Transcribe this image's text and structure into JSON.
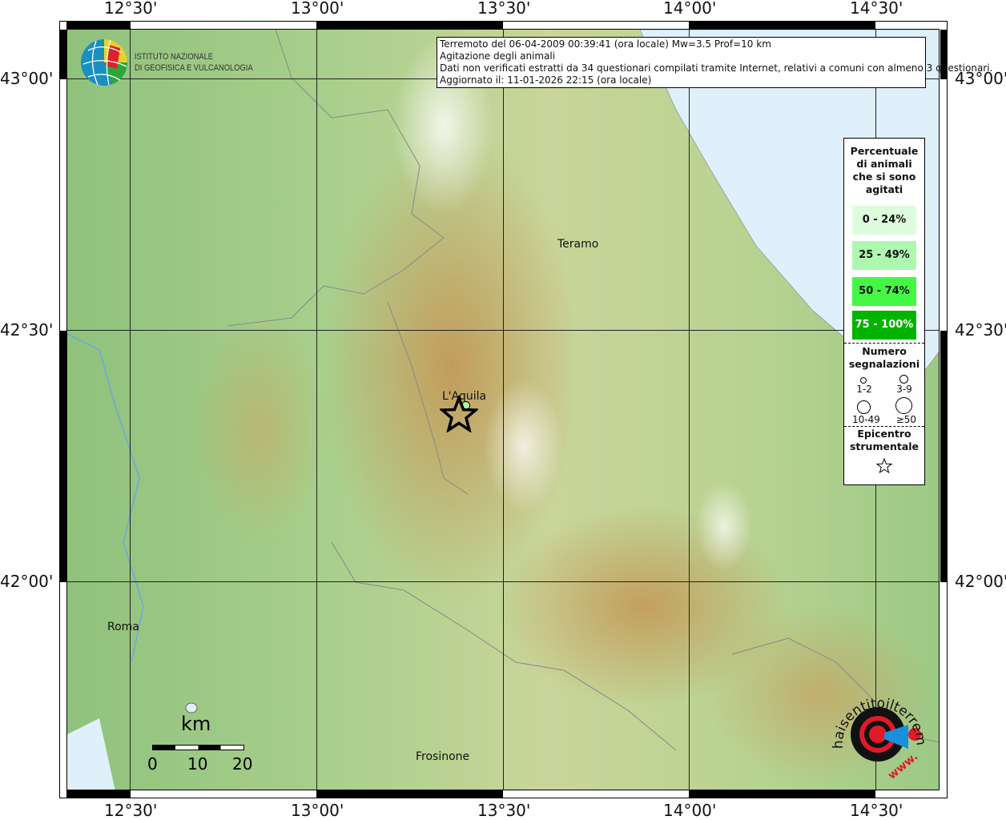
{
  "axes": {
    "lon_ticks": [
      "12°30'",
      "13°00'",
      "13°30'",
      "14°00'",
      "14°30'"
    ],
    "lat_ticks": [
      "43°00'",
      "42°30'",
      "42°00'"
    ]
  },
  "logo_ingv": {
    "line1": "ISTITUTO NAZIONALE",
    "line2": "DI GEOFISICA E VULCANOLOGIA"
  },
  "logo_hsit": {
    "text": "www.haisentitoilterremoto.it"
  },
  "info": {
    "line1": "Terremoto del 06-04-2009 00:39:41 (ora locale) Mw=3.5 Prof=10 km",
    "line2": "Agitazione degli animali",
    "line3": "Dati non verificati estratti da 34 questionari compilati tramite Internet, relativi a comuni con almeno 3 questionari.",
    "line4": "Aggiornato il: 11-01-2026 22:15 (ora locale)"
  },
  "legend": {
    "title": [
      "Percentuale",
      "di animali",
      "che si sono",
      "agitati"
    ],
    "classes": [
      {
        "label": "0 - 24%",
        "color": "#ddfcdd",
        "text_color": "#111111"
      },
      {
        "label": "25 - 49%",
        "color": "#aef7ae",
        "text_color": "#111111"
      },
      {
        "label": "50 - 74%",
        "color": "#44f744",
        "text_color": "#111111"
      },
      {
        "label": "75 - 100%",
        "color": "#00b400",
        "text_color": "#ffffff"
      }
    ],
    "count_title": [
      "Numero",
      "segnalazioni"
    ],
    "counts": [
      "1-2",
      "3-9",
      "10-49",
      "≥50"
    ],
    "epicenter_title": [
      "Epicentro",
      "strumentale"
    ],
    "epicenter_icon": "star-outline"
  },
  "cities": {
    "teramo": "Teramo",
    "laquila": "L'Aquila",
    "roma": "Roma",
    "frosinone": "Frosinone"
  },
  "scale": {
    "unit": "km",
    "labels": [
      "0",
      "10",
      "20"
    ]
  },
  "colors": {
    "sea": "#dff0fa",
    "epicenter": "#000000"
  }
}
